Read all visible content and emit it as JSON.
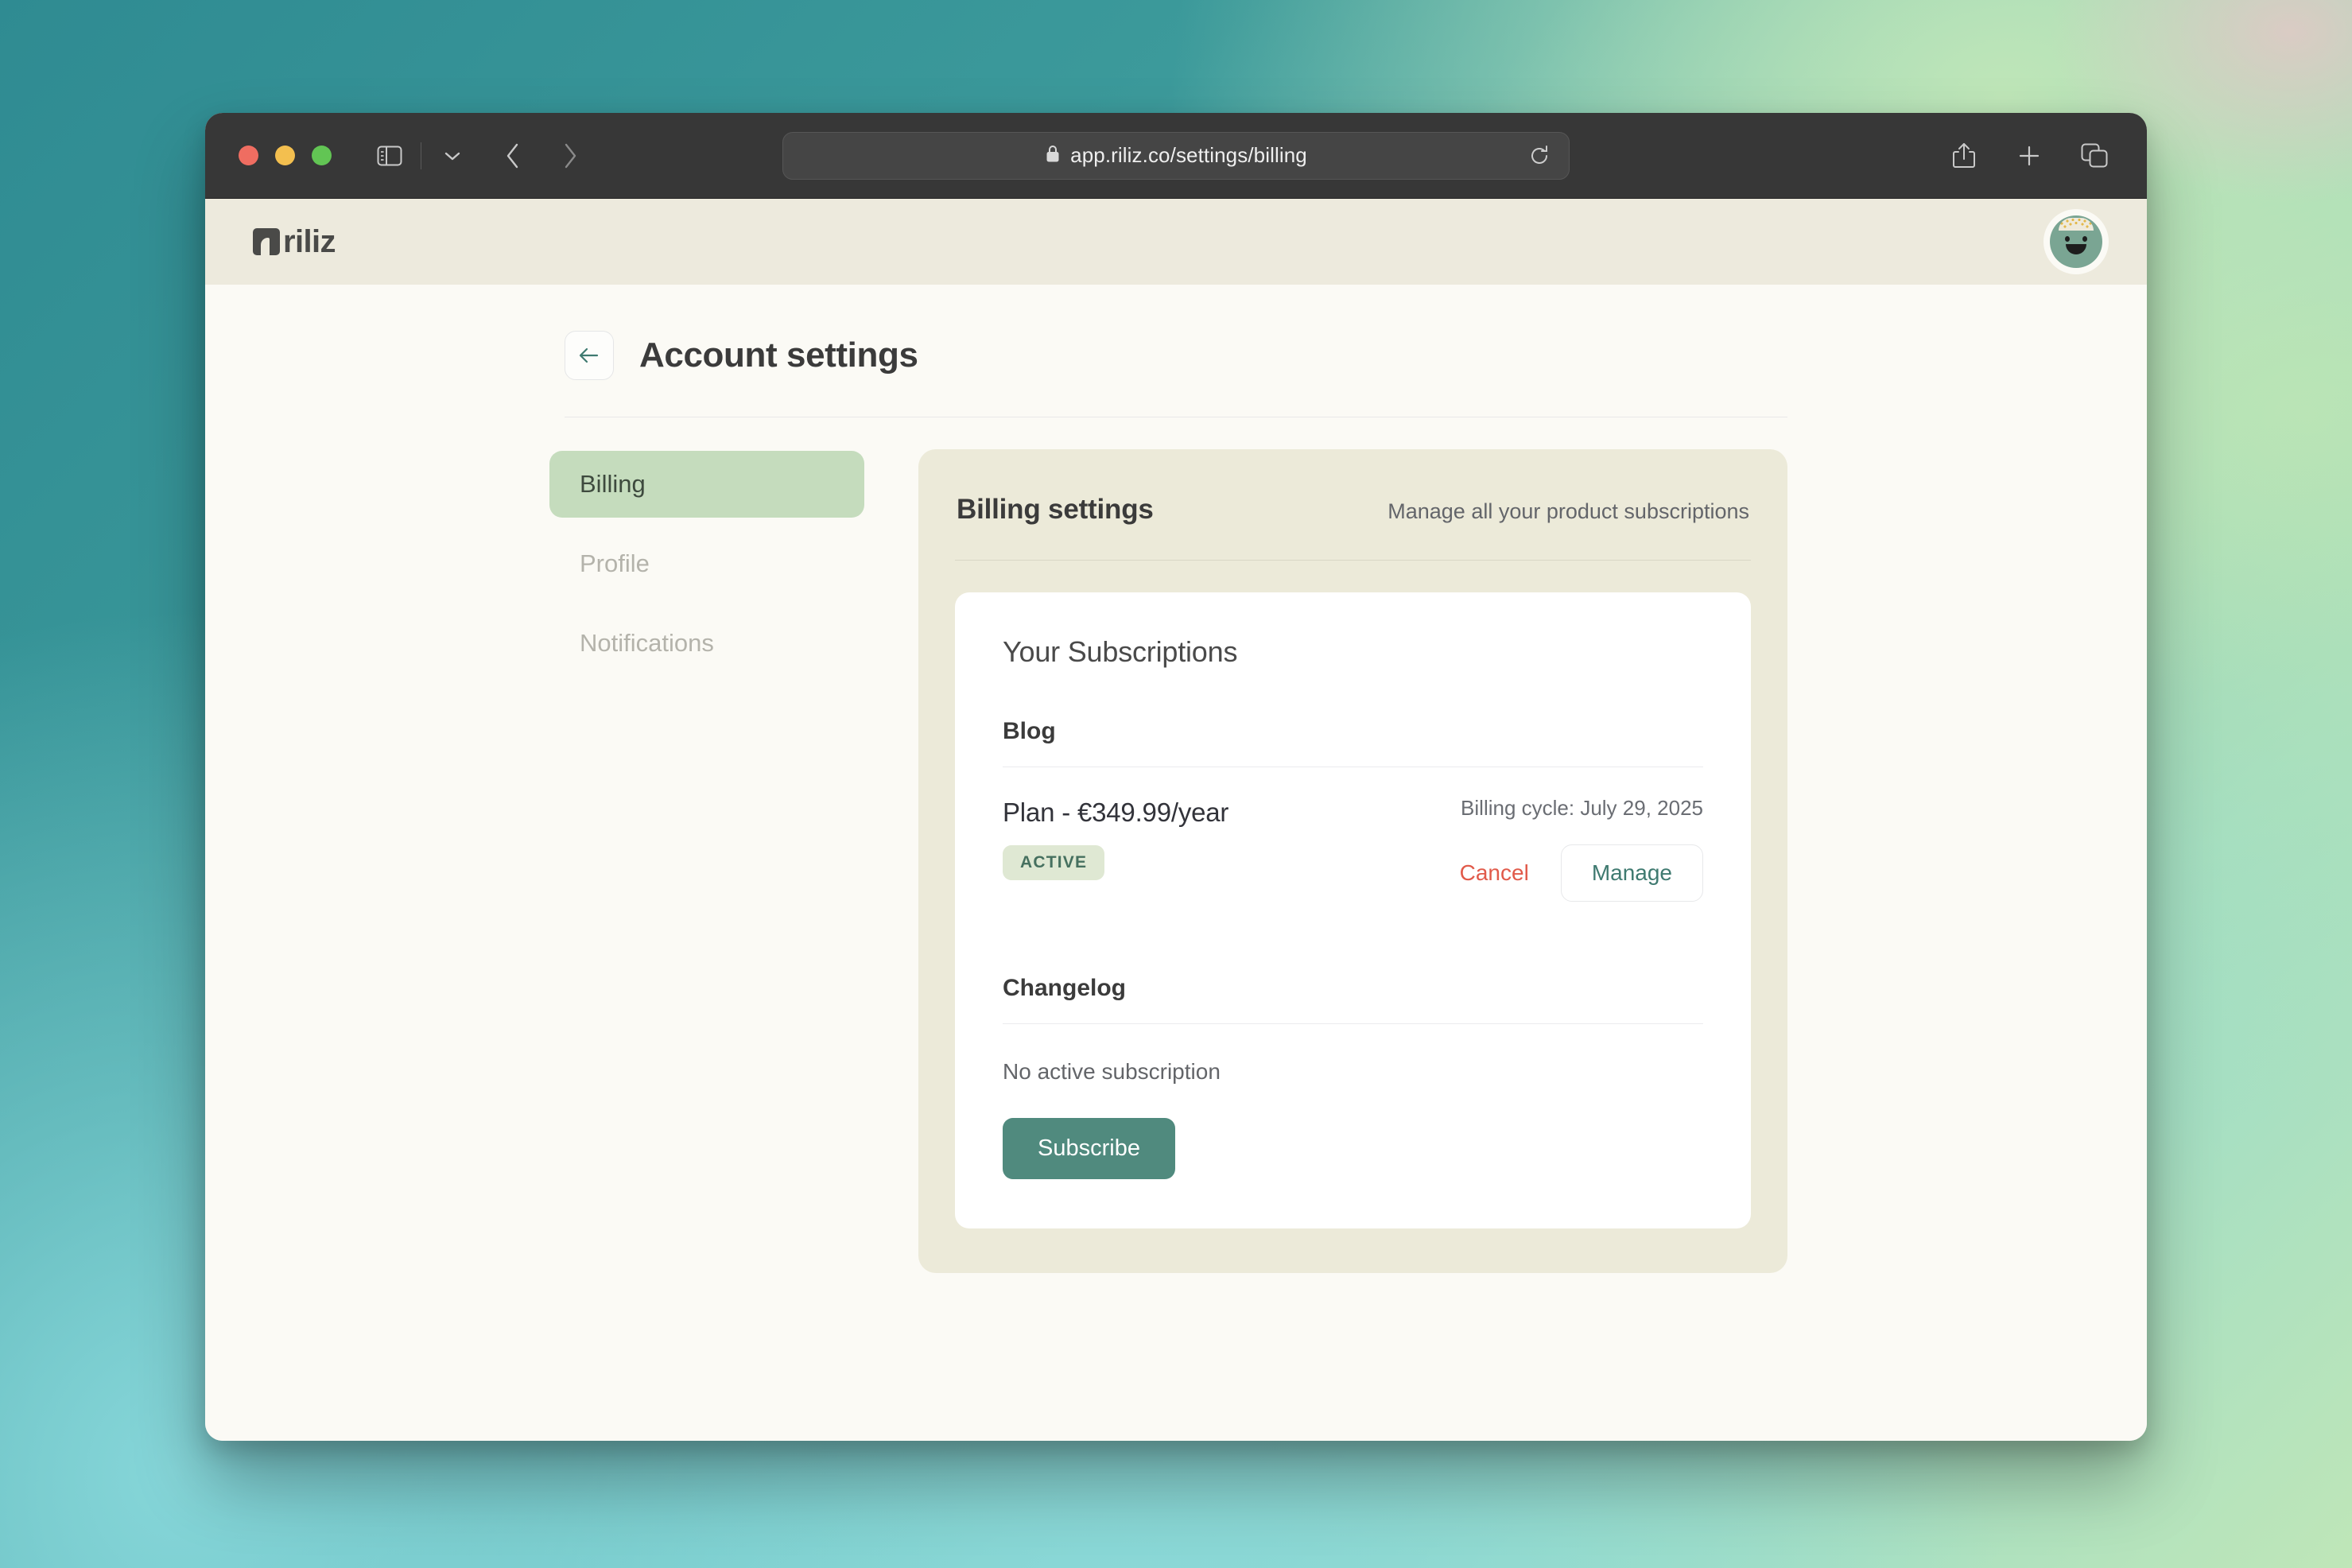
{
  "browser": {
    "url": "app.riliz.co/settings/billing",
    "lock_icon": "lock-icon",
    "reload_icon": "reload-icon",
    "sidebar_toggle_icon": "sidebar-toggle-icon",
    "tab_chevron_icon": "chevron-down-icon",
    "back_icon": "chevron-left-icon",
    "forward_icon": "chevron-right-icon",
    "share_icon": "share-icon",
    "new_tab_icon": "plus-icon",
    "tab_overview_icon": "tab-overview-icon",
    "traffic_lights": [
      "close-red",
      "minimize-yellow",
      "maximize-green"
    ]
  },
  "app_header": {
    "logo_text": "riliz",
    "logo_mark_icon": "riliz-logo-mark",
    "avatar_icon": "user-avatar-smiley"
  },
  "page": {
    "back_icon": "arrow-left-icon",
    "title": "Account settings"
  },
  "sidebar": {
    "items": [
      {
        "label": "Billing",
        "active": true
      },
      {
        "label": "Profile",
        "active": false
      },
      {
        "label": "Notifications",
        "active": false
      }
    ]
  },
  "panel": {
    "title": "Billing settings",
    "subtitle": "Manage all your product subscriptions"
  },
  "subscriptions": {
    "card_title": "Your Subscriptions",
    "products": [
      {
        "name": "Blog",
        "plan": "Plan - €349.99/year",
        "status_badge": "ACTIVE",
        "billing_cycle": "Billing cycle: July 29, 2025",
        "cancel_label": "Cancel",
        "manage_label": "Manage"
      },
      {
        "name": "Changelog",
        "empty_text": "No active subscription",
        "subscribe_label": "Subscribe"
      }
    ]
  },
  "colors": {
    "accent_teal": "#508a7e",
    "accent_green_pill": "#c5dcbd",
    "danger": "#e15a4a",
    "panel_beige": "#ecead9",
    "app_header_beige": "#edeadd",
    "page_bg": "#fbfaf5",
    "badge_bg": "#dfe8d3",
    "badge_text": "#46705f"
  }
}
